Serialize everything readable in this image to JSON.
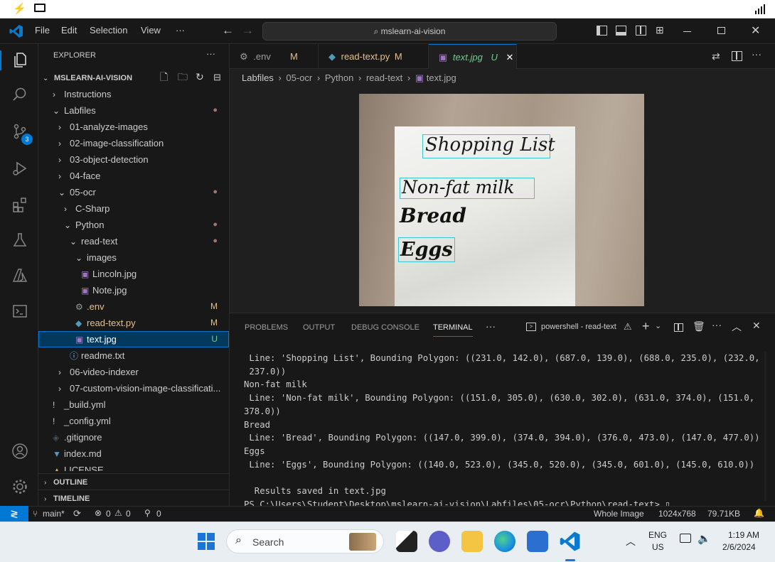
{
  "titlebar": {
    "menu": [
      "File",
      "Edit",
      "Selection",
      "View",
      "···"
    ],
    "command_center": "mslearn-ai-vision"
  },
  "activity_bar": {
    "scm_badge": "3"
  },
  "explorer": {
    "header": "EXPLORER",
    "more": "···",
    "root": "MSLEARN-AI-VISION",
    "items": [
      {
        "label": "Instructions",
        "chevron": "›",
        "indent": 0
      },
      {
        "label": "Labfiles",
        "chevron": "⌄",
        "indent": 0,
        "dot": "●"
      },
      {
        "label": "01-analyze-images",
        "chevron": "›",
        "indent": 1
      },
      {
        "label": "02-image-classification",
        "chevron": "›",
        "indent": 1
      },
      {
        "label": "03-object-detection",
        "chevron": "›",
        "indent": 1
      },
      {
        "label": "04-face",
        "chevron": "›",
        "indent": 1
      },
      {
        "label": "05-ocr",
        "chevron": "⌄",
        "indent": 1,
        "dot": "●"
      },
      {
        "label": "C-Sharp",
        "chevron": "›",
        "indent": 2
      },
      {
        "label": "Python",
        "chevron": "⌄",
        "indent": 2,
        "dot": "●"
      },
      {
        "label": "read-text",
        "chevron": "⌄",
        "indent": 3,
        "dot": "●"
      },
      {
        "label": "images",
        "chevron": "⌄",
        "indent": 4
      },
      {
        "label": "Lincoln.jpg",
        "icon": "▣",
        "indent": 5
      },
      {
        "label": "Note.jpg",
        "icon": "▣",
        "indent": 5
      },
      {
        "label": ".env",
        "icon": "⚙",
        "indent": 4,
        "badge": "M"
      },
      {
        "label": "read-text.py",
        "icon": "◆",
        "indent": 4,
        "badge": "M"
      },
      {
        "label": "text.jpg",
        "icon": "▣",
        "indent": 4,
        "badge": "U",
        "selected": true
      },
      {
        "label": "readme.txt",
        "icon": "ⓘ",
        "indent": 3
      },
      {
        "label": "06-video-indexer",
        "chevron": "›",
        "indent": 1
      },
      {
        "label": "07-custom-vision-image-classificati...",
        "chevron": "›",
        "indent": 1
      },
      {
        "label": "_build.yml",
        "icon": "!",
        "indent": 0
      },
      {
        "label": "_config.yml",
        "icon": "!",
        "indent": 0
      },
      {
        "label": ".gitignore",
        "icon": "◈",
        "indent": 0
      },
      {
        "label": "index.md",
        "icon": "▼",
        "indent": 0
      },
      {
        "label": "LICENSE",
        "icon": "▲",
        "indent": 0
      }
    ],
    "outline": "OUTLINE",
    "timeline": "TIMELINE"
  },
  "tabs": [
    {
      "label": ".env",
      "icon": "⚙",
      "badge": "M",
      "active": false
    },
    {
      "label": "read-text.py",
      "icon": "◆",
      "badge": "M",
      "active": false
    },
    {
      "label": "text.jpg",
      "icon": "▣",
      "badge": "U",
      "active": true
    }
  ],
  "breadcrumb": [
    "Labfiles",
    "05-ocr",
    "Python",
    "read-text",
    "text.jpg"
  ],
  "image": {
    "title": "Shopping List",
    "items": [
      "Non-fat milk",
      "Bread",
      "Eggs"
    ]
  },
  "panel": {
    "tabs": [
      "PROBLEMS",
      "OUTPUT",
      "DEBUG CONSOLE",
      "TERMINAL"
    ],
    "active_tab": "TERMINAL",
    "more": "···",
    "terminal_name": "powershell - read-text",
    "terminal_lines": [
      " Line: 'Shopping List', Bounding Polygon: ((231.0, 142.0), (687.0, 139.0), (688.0, 235.0), (232.0,",
      " 237.0))",
      "Non-fat milk",
      " Line: 'Non-fat milk', Bounding Polygon: ((151.0, 305.0), (630.0, 302.0), (631.0, 374.0), (151.0,",
      "378.0))",
      "Bread",
      " Line: 'Bread', Bounding Polygon: ((147.0, 399.0), (374.0, 394.0), (376.0, 473.0), (147.0, 477.0))",
      "Eggs",
      " Line: 'Eggs', Bounding Polygon: ((140.0, 523.0), (345.0, 520.0), (345.0, 601.0), (145.0, 610.0))",
      "",
      "  Results saved in text.jpg",
      "PS C:\\Users\\Student\\Desktop\\mslearn-ai-vision\\Labfiles\\05-ocr\\Python\\read-text> ▯"
    ]
  },
  "statusbar": {
    "remote": "≷",
    "branch": "main*",
    "sync": "⟳",
    "errors": "0",
    "warnings": "0",
    "ports": "0",
    "zoom_mode": "Whole Image",
    "dimensions": "1024x768",
    "size": "79.71KB"
  },
  "taskbar": {
    "search_placeholder": "Search",
    "lang": "ENG",
    "region": "US",
    "time": "1:19 AM",
    "date": "2/6/2024"
  },
  "colors": {
    "accent": "#0078d4",
    "modified": "#e2c08d",
    "untracked": "#73c991",
    "ocr_box": "#3fc5d1"
  }
}
